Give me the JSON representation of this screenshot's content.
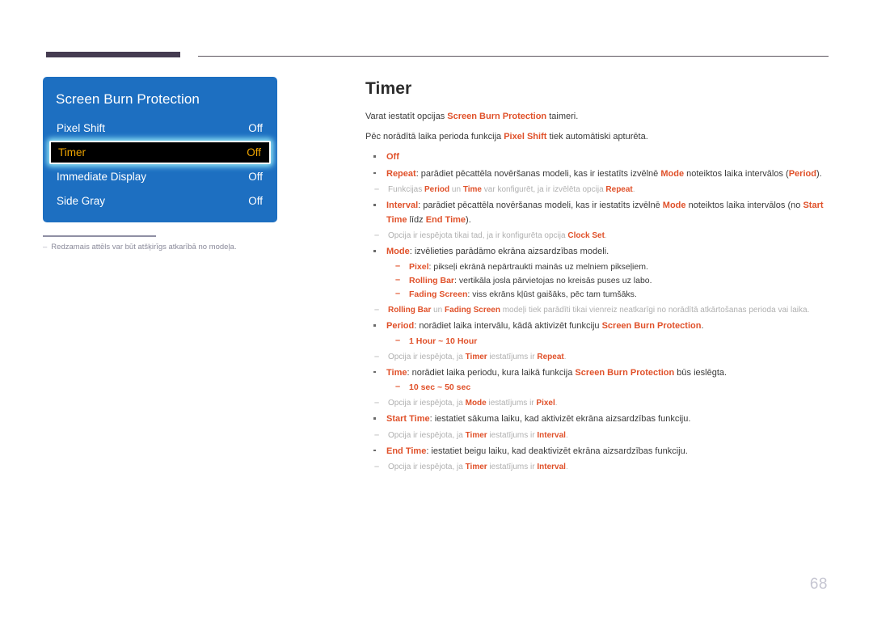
{
  "page": {
    "number": "68"
  },
  "osd": {
    "title": "Screen Burn Protection",
    "rows": [
      {
        "label": "Pixel Shift",
        "value": "Off",
        "selected": false
      },
      {
        "label": "Timer",
        "value": "Off",
        "selected": true
      },
      {
        "label": "Immediate Display",
        "value": "Off",
        "selected": false
      },
      {
        "label": "Side Gray",
        "value": "Off",
        "selected": false
      }
    ],
    "figure_note_dash": "–",
    "figure_note": "Redzamais attēls var būt atšķirīgs atkarībā no modeļa."
  },
  "content": {
    "title": "Timer",
    "intro1_a": "Varat iestatīt opcijas ",
    "intro1_b": "Screen Burn Protection",
    "intro1_c": " taimeri.",
    "intro2_a": "Pēc norādītā laika perioda funkcija ",
    "intro2_b": "Pixel Shift",
    "intro2_c": " tiek automātiski apturēta.",
    "off_label": "Off",
    "repeat_label": "Repeat",
    "repeat_text_a": ": parādiet pēcattēla novēršanas modeli, kas ir iestatīts izvēlnē ",
    "repeat_mode": "Mode",
    "repeat_text_b": " noteiktos laika intervālos (",
    "repeat_period": "Period",
    "repeat_text_c": ").",
    "note_repeat_a": "Funkcijas ",
    "note_repeat_period": "Period",
    "note_repeat_b": " un ",
    "note_repeat_time": "Time",
    "note_repeat_c": " var konfigurēt, ja ir izvēlēta opcija ",
    "note_repeat_d": "Repeat",
    "note_repeat_e": ".",
    "interval_label": "Interval",
    "interval_text_a": ": parādiet pēcattēla novēršanas modeli, kas ir iestatīts izvēlnē ",
    "interval_mode": "Mode",
    "interval_text_b": " noteiktos laika intervālos (no ",
    "interval_start": "Start Time",
    "interval_text_c": " līdz ",
    "interval_end": "End Time",
    "interval_text_d": ").",
    "note_clock_a": "Opcija ir iespējota tikai tad, ja ir konfigurēta opcija ",
    "note_clock_b": "Clock Set",
    "note_clock_c": ".",
    "mode_label": "Mode",
    "mode_text": ": izvēlieties parādāmo ekrāna aizsardzības modeli.",
    "mode_pixel_label": "Pixel",
    "mode_pixel_text": ": pikseļi ekrānā nepārtraukti mainās uz melniem pikseļiem.",
    "mode_rolling_label": "Rolling Bar",
    "mode_rolling_text": ": vertikāla josla pārvietojas no kreisās puses uz labo.",
    "mode_fading_label": "Fading Screen",
    "mode_fading_text": ": viss ekrāns kļūst gaišāks, pēc tam tumšāks.",
    "note_mode_a": "Rolling Bar",
    "note_mode_b": " un ",
    "note_mode_c": "Fading Screen",
    "note_mode_d": " modeļi tiek parādīti tikai vienreiz neatkarīgi no norādītā atkārtošanas perioda vai laika.",
    "period_label": "Period",
    "period_text_a": ": norādiet laika intervālu, kādā aktivizēt funkciju ",
    "period_sbp": "Screen Burn Protection",
    "period_text_b": ".",
    "period_range": "1 Hour ~ 10 Hour",
    "note_period_a": "Opcija ir iespējota, ja ",
    "note_period_timer": "Timer",
    "note_period_b": " iestatījums ir ",
    "note_period_repeat": "Repeat",
    "note_period_c": ".",
    "time_label": "Time",
    "time_text_a": ": norādiet laika periodu, kura laikā funkcija ",
    "time_sbp": "Screen Burn Protection",
    "time_text_b": " būs ieslēgta.",
    "time_range": "10 sec ~ 50 sec",
    "note_time_a": "Opcija ir iespējota, ja ",
    "note_time_mode": "Mode",
    "note_time_b": " iestatījums ir ",
    "note_time_pixel": "Pixel",
    "note_time_c": ".",
    "start_label": "Start Time",
    "start_text": ": iestatiet sākuma laiku, kad aktivizēt ekrāna aizsardzības funkciju.",
    "note_start_a": "Opcija ir iespējota, ja ",
    "note_start_timer": "Timer",
    "note_start_b": " iestatījums ir ",
    "note_start_interval": "Interval",
    "note_start_c": ".",
    "end_label": "End Time",
    "end_text": ": iestatiet beigu laiku, kad deaktivizēt ekrāna aizsardzības funkciju.",
    "note_end_a": "Opcija ir iespējota, ja ",
    "note_end_timer": "Timer",
    "note_end_b": " iestatījums ir ",
    "note_end_interval": "Interval",
    "note_end_c": ".",
    "dash_marker": "–",
    "note_dash_marker": "–"
  },
  "colors": {
    "accent": "#e0512a",
    "osd_blue": "#1d6fc1",
    "rule_purple": "#453c51",
    "selected_text": "#f0a500",
    "note_gray": "#b0b0b0"
  }
}
